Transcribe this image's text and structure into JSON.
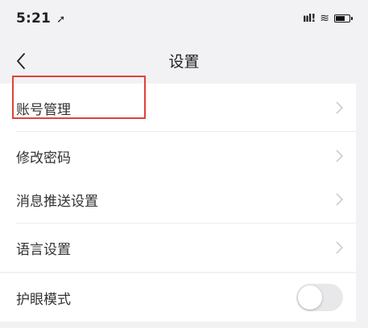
{
  "status_bar": {
    "time": "5:21",
    "time_arrow": "➚",
    "signal": "ııl!",
    "wifi": "≋"
  },
  "nav": {
    "title": "设置",
    "back_icon": "chevron-left-icon"
  },
  "groups": [
    {
      "items": [
        {
          "label": "账号管理",
          "highlighted": true
        },
        {
          "label": "修改密码"
        }
      ]
    },
    {
      "items": [
        {
          "label": "消息推送设置"
        },
        {
          "label": "语言设置"
        }
      ]
    },
    {
      "items": [
        {
          "label": "护眼模式",
          "toggle": false
        }
      ]
    }
  ],
  "colors": {
    "highlight": "#e0413b",
    "background": "#f2f2f4",
    "chevron": "#c7c7cc"
  }
}
